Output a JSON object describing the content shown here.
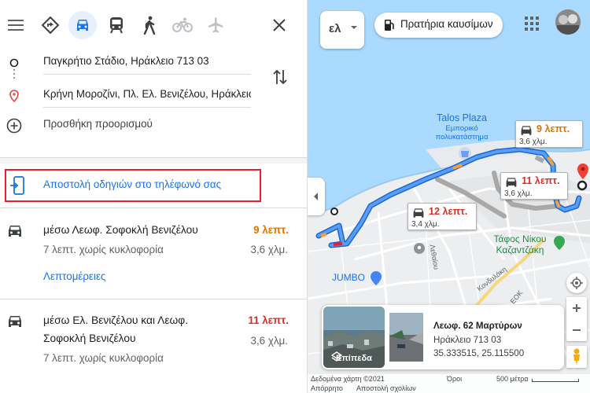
{
  "travel_modes": {
    "menu_icon": "hamburger-menu-icon",
    "items": [
      "best-route-icon",
      "car-icon",
      "transit-icon",
      "walk-icon",
      "bike-icon",
      "flight-icon"
    ],
    "active": "car-icon",
    "close_icon": "close-icon"
  },
  "waypoints": {
    "origin": "Παγκρήτιο Στάδιο, Ηράκλειο 713 03",
    "destination": "Κρήνη Μοροζίνι, Πλ. Ελ. Βενιζέλου, Ηράκλειο",
    "add_destination": "Προσθήκη προορισμού"
  },
  "send_to_phone": "Αποστολή οδηγιών στο τηλέφωνό σας",
  "routes": [
    {
      "via_line1": "μέσω Λεωφ. Σοφοκλή Βενιζέλου",
      "via_line2": "",
      "time": "9 λεπτ.",
      "time_color": "#e37400",
      "traffic": "7 λεπτ. χωρίς κυκλοφορία",
      "distance": "3,6 χλμ.",
      "details": "Λεπτομέρειες"
    },
    {
      "via_line1": "μέσω Ελ. Βενιζέλου και Λεωφ.",
      "via_line2": "Σοφοκλή Βενιζέλου",
      "time": "11 λεπτ.",
      "time_color": "#d93025",
      "traffic": "7 λεπτ. χωρίς κυκλοφορία",
      "distance": "3,6 χλμ."
    }
  ],
  "map": {
    "language_button": "ελ",
    "fuel_chip": "Πρατήρια καυσίμων",
    "eta_bubbles": [
      {
        "time": "9 λεπτ.",
        "distance": "3,6 χλμ.",
        "color": "#e37400"
      },
      {
        "time": "11 λεπτ.",
        "distance": "3,6 χλμ.",
        "color": "#d93025"
      },
      {
        "time": "12 λεπτ.",
        "distance": "3,4 χλμ.",
        "color": "#d93025"
      }
    ],
    "labels": {
      "talos_title": "Talos Plaza",
      "talos_sub1": "Εμπορικό",
      "talos_sub2": "πολυκατάστημα",
      "tomb_line1": "Τάφος Νίκου",
      "tomb_line2": "Καζαντζάκη",
      "jumbo": "JUMBO",
      "street_lethaiou": "Λεθαίου",
      "street_kondylaki": "Κονδυλάκη",
      "eok": "ΕΟΚ"
    },
    "place_card": {
      "layers_label": "Επίπεδα",
      "title": "Λεωφ. 62 Μαρτύρων",
      "address": "Ηράκλειο 713 03",
      "coords": "35.333515, 25.115500"
    },
    "footer": {
      "map_data": "Δεδομένα χάρτη ©2021",
      "terms": "Όροι",
      "scale": "500 μέτρα",
      "privacy": "Απόρρητο",
      "feedback": "Αποστολή σχολίων"
    },
    "route_color": "#4285f4",
    "alt_route_color": "#a8a8a8",
    "traffic_slow_color": "#f2a13b",
    "traffic_heavy_color": "#e8202c"
  }
}
